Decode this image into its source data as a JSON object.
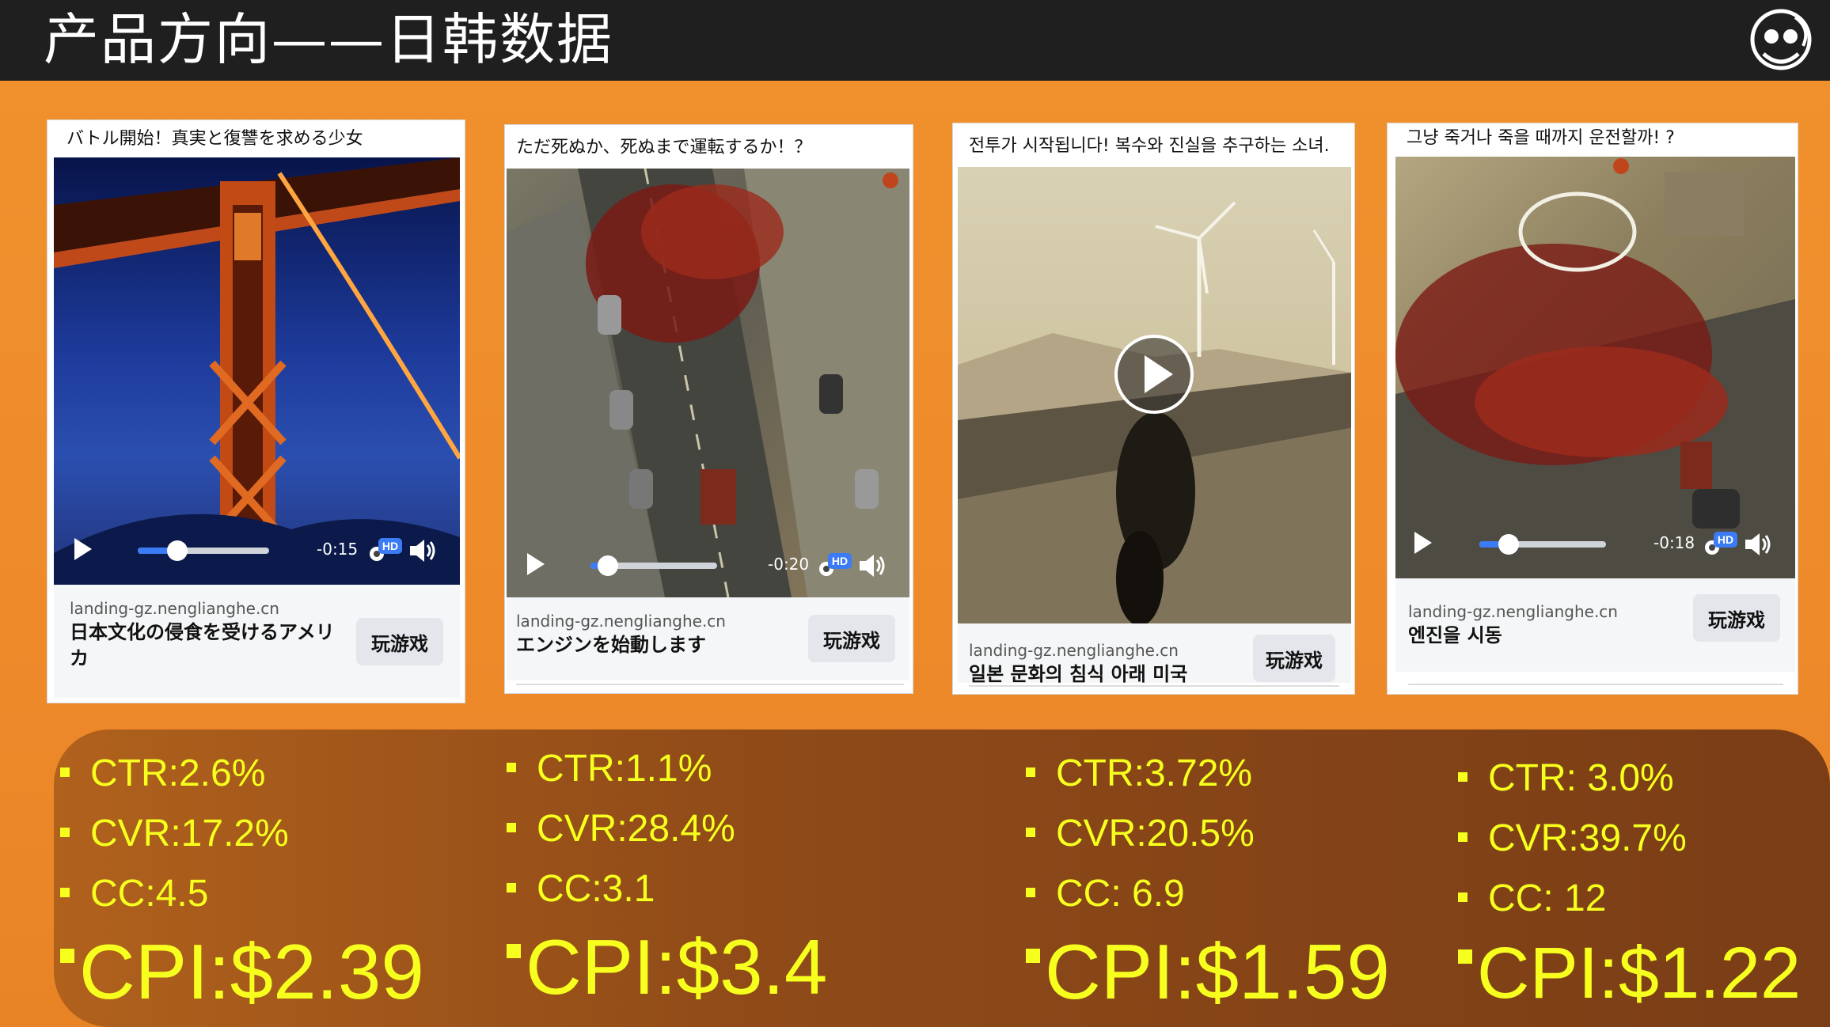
{
  "header": {
    "title": "产品方向——日韩数据"
  },
  "cards": [
    {
      "headline": "バトル開始！真実と復讐を求める少女",
      "time": "-0:15",
      "hd": "HD",
      "domain": "landing-gz.nenglianghe.cn",
      "desc": "日本文化の侵食を受けるアメリカ",
      "cta": "玩游戏",
      "progress": 0.3
    },
    {
      "headline": "ただ死ぬか、死ぬまで運転するか！？",
      "time": "-0:20",
      "hd": "HD",
      "domain": "landing-gz.nenglianghe.cn",
      "desc": "エンジンを始動します",
      "cta": "玩游戏",
      "progress": 0.14
    },
    {
      "headline": "전투가 시작됩니다! 복수와 진실을 추구하는 소녀.",
      "time": "",
      "domain": "landing-gz.nenglianghe.cn",
      "desc": "일본 문화의 침식 아래 미국",
      "cta": "玩游戏"
    },
    {
      "headline": "그냥 죽거나 죽을 때까지 운전할까! ?",
      "time": "-0:18",
      "hd": "HD",
      "domain": "landing-gz.nenglianghe.cn",
      "desc": "엔진을 시동",
      "cta": "玩游戏",
      "progress": 0.23
    }
  ],
  "stats": [
    {
      "ctr": "CTR:2.6%",
      "cvr": "CVR:17.2%",
      "cc": "CC:4.5",
      "cpi": "CPI:$2.39"
    },
    {
      "ctr": "CTR:1.1%",
      "cvr": "CVR:28.4%",
      "cc": "CC:3.1",
      "cpi": "CPI:$3.4"
    },
    {
      "ctr": "CTR:3.72%",
      "cvr": "CVR:20.5%",
      "cc": "CC: 6.9",
      "cpi": "CPI:$1.59"
    },
    {
      "ctr": "CTR: 3.0%",
      "cvr": "CVR:39.7%",
      "cc": "CC: 12",
      "cpi": "CPI:$1.22"
    }
  ],
  "colors": {
    "accent_orange": "#ee8a2a",
    "stat_yellow": "#f6ff1e",
    "header_bg": "#1f1f1f",
    "video_progress": "#3b7bf5"
  },
  "icons": [
    "logo-icon",
    "play-icon",
    "settings-icon",
    "hd-badge",
    "volume-icon",
    "play-overlay-icon"
  ]
}
